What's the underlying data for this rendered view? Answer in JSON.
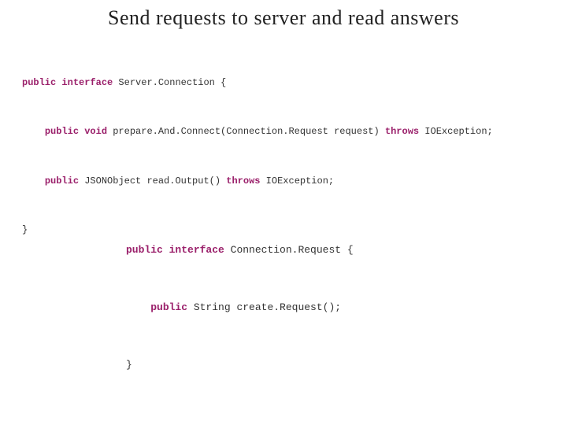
{
  "title": "Send requests to server and read answers",
  "code1": {
    "kw_public": "public",
    "kw_interface": "interface",
    "iface_name": " Server.Connection {",
    "m1_pre": "    ",
    "m1_kw": "public void",
    "m1_rest": " prepare.And.Connect(Connection.Request request) ",
    "m1_throws": "throws",
    "m1_ex": " IOException;",
    "m2_pre": "    ",
    "m2_kw": "public",
    "m2_rest": " JSONObject read.Output() ",
    "m2_throws": "throws",
    "m2_ex": " IOException;",
    "close": "}"
  },
  "code2": {
    "kw_public": "public",
    "kw_interface": "interface",
    "iface_name": " Connection.Request {",
    "m1_pre": "    ",
    "m1_kw": "public",
    "m1_rest": " String create.Request();",
    "close": "}"
  }
}
